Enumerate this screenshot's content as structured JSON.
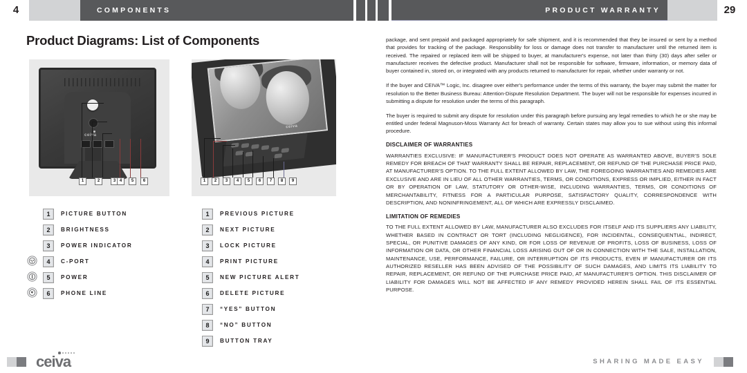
{
  "header": {
    "page_left": "4",
    "page_right": "29",
    "title_left": "COMPONENTS",
    "title_right": "PRODUCT WARRANTY",
    "bar_color": "#58595b",
    "box_color": "#d2d3d5"
  },
  "page_title": "Product Diagrams: List of Components",
  "diagrams": {
    "left": {
      "caption_count": 6,
      "callouts": [
        "1",
        "2",
        "3",
        "4",
        "5",
        "6"
      ]
    },
    "right": {
      "caption_count": 9,
      "callouts": [
        "1",
        "2",
        "3",
        "4",
        "5",
        "6",
        "7",
        "8",
        "9"
      ]
    }
  },
  "legend_left": [
    {
      "num": "1",
      "label": "PICTURE BUTTON",
      "icon": ""
    },
    {
      "num": "2",
      "label": "BRIGHTNESS",
      "icon": ""
    },
    {
      "num": "3",
      "label": "POWER INDICATOR",
      "icon": ""
    },
    {
      "num": "4",
      "label": "C-PORT",
      "icon": "c-port-jack-icon"
    },
    {
      "num": "5",
      "label": "POWER",
      "icon": "power-jack-icon"
    },
    {
      "num": "6",
      "label": "PHONE LINE",
      "icon": "phone-jack-icon"
    }
  ],
  "legend_right": [
    {
      "num": "1",
      "label": "PREVIOUS PICTURE"
    },
    {
      "num": "2",
      "label": "NEXT PICTURE"
    },
    {
      "num": "3",
      "label": "LOCK PICTURE"
    },
    {
      "num": "4",
      "label": "PRINT PICTURE"
    },
    {
      "num": "5",
      "label": "NEW PICTURE ALERT"
    },
    {
      "num": "6",
      "label": "DELETE PICTURE"
    },
    {
      "num": "7",
      "label": "“YES” BUTTON"
    },
    {
      "num": "8",
      "label": "“NO” BUTTON"
    },
    {
      "num": "9",
      "label": "BUTTON TRAY"
    }
  ],
  "warranty": {
    "p1": "package, and sent prepaid and packaged appropriately for safe shipment, and it is recommended that they be insured or sent by a method that provides for tracking of the package. Responsibility for loss or damage does not transfer to manufacturer until the returned item is received. The repaired or replaced item will be shipped to buyer, at manufacturer's expense, not later than thirty (30) days after seller or manufacturer receives the defective product. Manufacturer shall not be responsible for software, firmware, information, or memory data of buyer contained in, stored on, or integrated with any products returned to manufacturer for repair, whether under warranty or not.",
    "p2": "If the buyer and CEIVA™ Logic, Inc. disagree over either's performance under the terms of this warranty, the buyer may submit the matter for resolution to the Better Business Bureau: Attention-Dispute Resolution Department. The buyer will not be responsible for expenses incurred in submitting a dispute for resolution under the terms of this paragraph.",
    "p3": "The buyer is required to submit any dispute for resolution under this paragraph before pursuing any legal remedies to which he or she may be entitled under federal Magnuson-Moss Warranty Act for breach of warranty. Certain states may allow you to sue without using this informal procedure.",
    "head1": "DISCLAIMER OF WARRANTIES",
    "p4": "WARRANTIES EXCLUSIVE: IF MANUFACTURER'S PRODUCT DOES NOT OPERATE AS WARRANTED ABOVE, BUYER'S SOLE REMEDY FOR BREACH OF THAT WARRANTY SHALL BE REPAIR, REPLACEMENT, OR REFUND OF THE PURCHASE PRICE PAID, AT MANUFACTURER'S OPTION. TO THE FULL EXTENT ALLOWED BY LAW, THE FOREGOING WARRANTIES AND REMEDIES ARE EXCLUSIVE AND ARE IN LIEU OF ALL OTHER WARRANTIES, TERMS, OR CONDITIONS, EXPRESS OR IMPLIED, EITHER IN FACT OR BY OPERATION OF LAW, STATUTORY OR OTHER-WISE, INCLUDING WARRANTIES, TERMS, OR CONDITIONS OF MERCHANTABILITY, FITNESS FOR A PARTICULAR PURPOSE, SATISFACTORY QUALITY, CORRESPONDENCE WITH DESCRIPTION, AND NONINFRINGEMENT, ALL OF WHICH ARE EXPRESSLY DISCLAIMED.",
    "head2": "LIMITATION OF REMEDIES",
    "p5": "TO THE FULL EXTENT ALLOWED BY LAW, MANUFACTURER ALSO EXCLUDES FOR ITSELF AND ITS SUPPLIERS ANY LIABILITY, WHETHER BASED IN CONTRACT OR TORT (INCLUDING NEGLIGENCE), FOR INCIDENTAL, CONSEQUENTIAL, INDIRECT, SPECIAL, OR PUNITIVE DAMAGES OF ANY KIND, OR FOR LOSS OF REVENUE OF PROFITS, LOSS OF BUSINESS, LOSS OF INFORMATION OR DATA, OR OTHER FINANCIAL LOSS ARISING OUT OF OR IN CONNECTION WITH THE SALE, INSTALLATION, MAINTENANCE, USE, PERFORMANCE, FAILURE, OR INTERRUPTION OF ITS PRODUCTS, EVEN IF MANUFACTURER OR ITS AUTHORIZED RESELLER HAS BEEN ADVISED OF THE POSSIBILITY OF SUCH DAMAGES, AND LIMITS ITS LIABILITY TO REPAIR, REPLACEMENT, OR REFUND OF THE PURCHASE PRICE PAID, AT MANUFACTURER'S OPTION. THIS DISCLAIMER OF LIABILITY FOR DAMAGES WILL NOT BE AFFECTED IF ANY REMEDY PROVIDED HEREIN SHALL FAIL OF ITS ESSENTIAL PURPOSE."
  },
  "footer": {
    "logo": "ceiva",
    "logo_tm": ".",
    "tagline": "SHARING MADE EASY",
    "square_light": "#d2d3d5",
    "square_dark": "#7b7c80"
  }
}
